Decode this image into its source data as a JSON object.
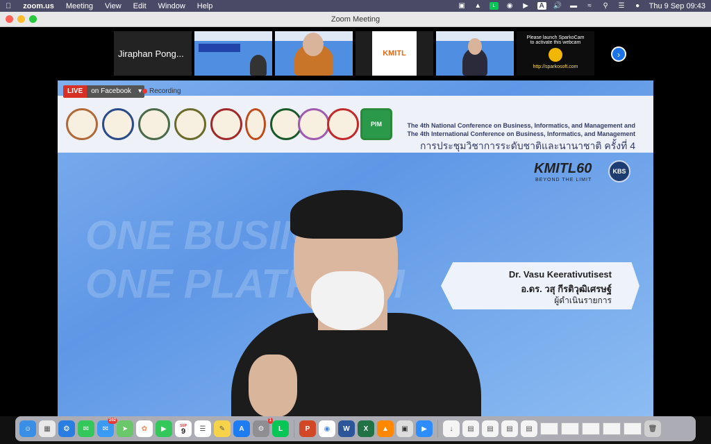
{
  "menubar": {
    "app": "zoom.us",
    "items": [
      "Meeting",
      "View",
      "Edit",
      "Window",
      "Help"
    ],
    "clock": "Thu 9 Sep  09:43"
  },
  "window": {
    "title": "Zoom Meeting"
  },
  "thumbnails": {
    "first_name": "Jiraphan Pong...",
    "sparko_line1": "Please launch SparkoCam",
    "sparko_line2": "to activate this webcam",
    "sparko_url": "http://sparkosoft.com",
    "kmitl_logo": "KMITL"
  },
  "stream": {
    "live_label": "LIVE",
    "destination": "on Facebook",
    "recording_label": "Recording"
  },
  "banner": {
    "line1": "The 4th National Conference on Business, Informatics, and Management and",
    "line2": "The 4th International Conference on Business, Informatics, and Management",
    "thai": "การประชุมวิชาการระดับชาติและนานาชาติ ครั้งที่ 4",
    "pim": "PIM"
  },
  "logos": {
    "kmitl": "KMITL60",
    "tagline": "BEYOND THE LIMIT",
    "kbs": "KBS"
  },
  "lower_third": {
    "name_en": "Dr. Vasu Keerativutisest",
    "name_th": "อ.ดร. วสุ กีรติวุฒิเศรษฐ์",
    "role": "ผู้ดำเนินรายการ"
  },
  "background_text": {
    "line1": "ONE BUSINESS",
    "line2": "ONE PLATFORM"
  },
  "dock": {
    "calendar_month": "SEP",
    "calendar_day": "9",
    "mail_badge": "202",
    "settings_badge": "1"
  }
}
